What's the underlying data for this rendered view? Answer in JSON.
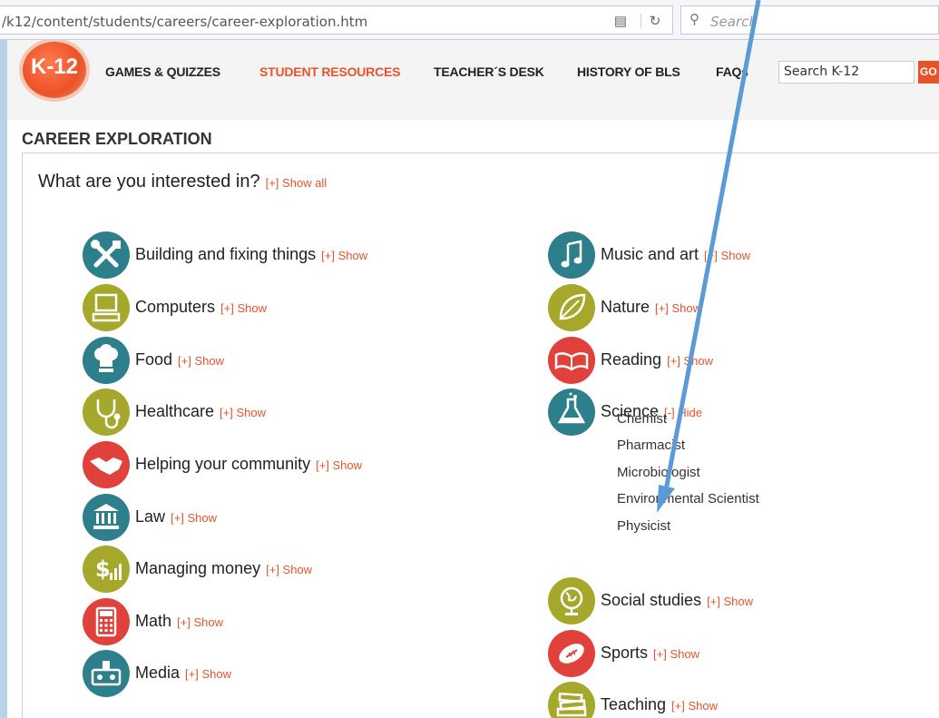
{
  "browser": {
    "url": "/k12/content/students/careers/career-exploration.htm",
    "search_placeholder": "Search"
  },
  "site": {
    "logo": "K-12",
    "nav": [
      "GAMES & QUIZZES",
      "STUDENT RESOURCES",
      "TEACHER´S DESK",
      "HISTORY OF BLS",
      "FAQs"
    ],
    "active_nav": "STUDENT RESOURCES",
    "search_value": "Search K-12",
    "go_label": "GO"
  },
  "section_title": "CAREER EXPLORATION",
  "question": "What are you interested in?",
  "show_all": "[+] Show all",
  "left_categories": [
    {
      "label": "Building and fixing things",
      "toggle": "[+] Show",
      "icon": "tools-icon",
      "color": "#2e7f8c"
    },
    {
      "label": "Computers",
      "toggle": "[+] Show",
      "icon": "computer-icon",
      "color": "#a6a82b"
    },
    {
      "label": "Food",
      "toggle": "[+] Show",
      "icon": "chef-hat-icon",
      "color": "#2e7f8c"
    },
    {
      "label": "Healthcare",
      "toggle": "[+] Show",
      "icon": "stethoscope-icon",
      "color": "#a6a82b"
    },
    {
      "label": "Helping your community",
      "toggle": "[+] Show",
      "icon": "handshake-icon",
      "color": "#e0413b"
    },
    {
      "label": "Law",
      "toggle": "[+] Show",
      "icon": "courthouse-icon",
      "color": "#2e7f8c"
    },
    {
      "label": "Managing money",
      "toggle": "[+] Show",
      "icon": "money-icon",
      "color": "#a6a82b"
    },
    {
      "label": "Math",
      "toggle": "[+] Show",
      "icon": "calculator-icon",
      "color": "#e0413b"
    },
    {
      "label": "Media",
      "toggle": "[+] Show",
      "icon": "media-icon",
      "color": "#2e7f8c"
    }
  ],
  "right_categories": [
    {
      "label": "Music and art",
      "toggle": "[+] Show",
      "icon": "music-note-icon",
      "color": "#2e7f8c"
    },
    {
      "label": "Nature",
      "toggle": "[+] Show",
      "icon": "leaf-icon",
      "color": "#a6a82b"
    },
    {
      "label": "Reading",
      "toggle": "[+] Show",
      "icon": "book-icon",
      "color": "#e0413b"
    },
    {
      "label": "Science",
      "toggle": "[-] Hide",
      "icon": "flask-icon",
      "color": "#2e7f8c"
    },
    {
      "label": "Social studies",
      "toggle": "[+] Show",
      "icon": "globe-icon",
      "color": "#a6a82b"
    },
    {
      "label": "Sports",
      "toggle": "[+] Show",
      "icon": "football-icon",
      "color": "#e0413b"
    },
    {
      "label": "Teaching",
      "toggle": "[+] Show",
      "icon": "books-icon",
      "color": "#a6a82b"
    }
  ],
  "science_careers": [
    "Chemist",
    "Pharmacist",
    "Microbiologist",
    "Environmental Scientist",
    "Physicist"
  ],
  "annotation_color": "#5b9bd5"
}
